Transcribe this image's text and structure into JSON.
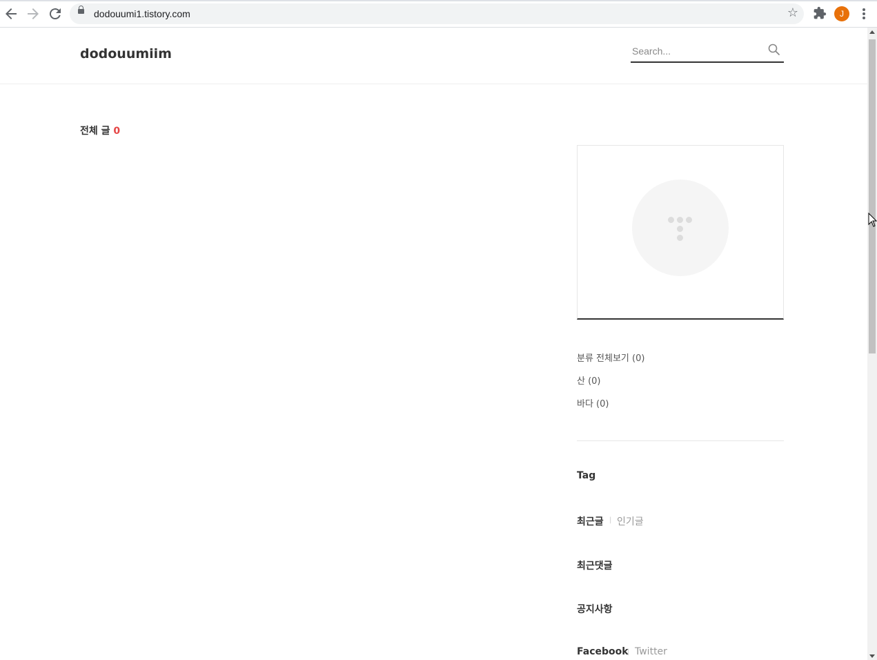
{
  "browser": {
    "url": "dodouumi1.tistory.com",
    "profile_initial": "J",
    "colors": {
      "profile": "#e8710a"
    }
  },
  "blog": {
    "title": "dodouumiim",
    "search_placeholder": "Search..."
  },
  "main": {
    "heading": "전체 글",
    "count": "0",
    "colors": {
      "count": "#e54545"
    }
  },
  "sidebar": {
    "categories": [
      {
        "label": "분류 전체보기 (0)"
      },
      {
        "label": "산 (0)"
      },
      {
        "label": "바다 (0)"
      }
    ],
    "tag_title": "Tag",
    "posts_tabs": {
      "recent": "최근글",
      "popular": "인기글"
    },
    "recent_comments_title": "최근댓글",
    "notice_title": "공지사항",
    "social_tabs": {
      "facebook": "Facebook",
      "twitter": "Twitter"
    }
  }
}
